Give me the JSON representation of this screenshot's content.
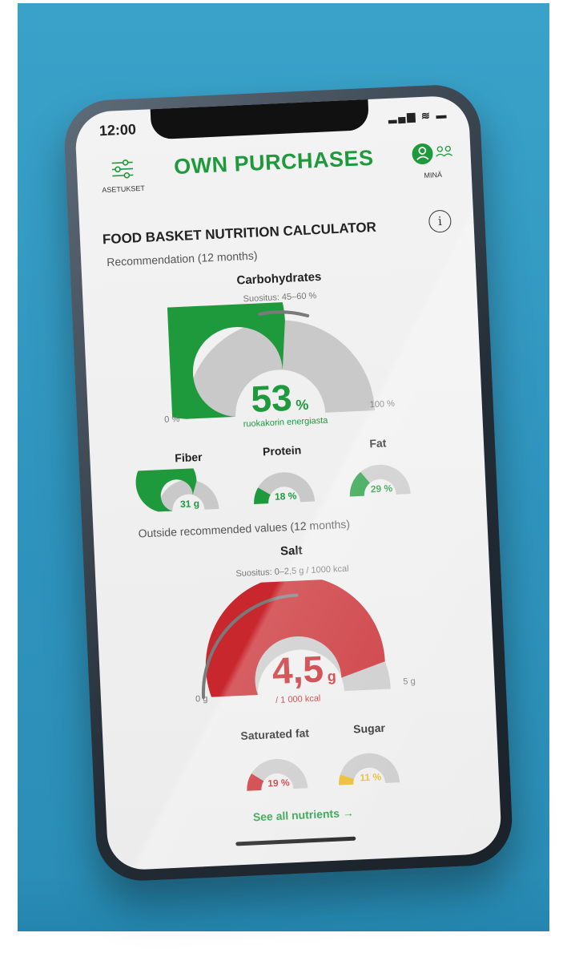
{
  "status_bar": {
    "time": "12:00"
  },
  "header": {
    "settings_label": "ASETUKSET",
    "title": "OWN PURCHASES",
    "user_label": "MINÄ"
  },
  "calculator": {
    "title": "FOOD BASKET NUTRITION CALCULATOR",
    "recommendation_label": "Recommendation (12 months)",
    "carbohydrates": {
      "title": "Carbohydrates",
      "recommendation": "Suositus: 45–60 %",
      "value": "53",
      "unit": "%",
      "caption": "ruokakorin energiasta",
      "min_label": "0 %",
      "max_label": "100 %",
      "level": 0.53
    },
    "small_gauges": [
      {
        "title": "Fiber",
        "value": "31 g",
        "level": 0.6
      },
      {
        "title": "Protein",
        "value": "18 %",
        "level": 0.18
      },
      {
        "title": "Fat",
        "value": "29 %",
        "level": 0.29
      }
    ],
    "outside_label": "Outside recommended values (12 months)",
    "salt": {
      "title": "Salt",
      "recommendation": "Suositus: 0–2,5 g / 1000 kcal",
      "value": "4,5",
      "unit": "g",
      "caption": "/ 1 000 kcal",
      "min_label": "0 g",
      "max_label": "5 g",
      "level": 0.9
    },
    "outside_gauges": [
      {
        "title": "Saturated fat",
        "value": "19 %",
        "level": 0.19
      },
      {
        "title": "Sugar",
        "value": "11 %",
        "level": 0.11
      }
    ],
    "see_all": "See all nutrients →"
  },
  "colors": {
    "green": "#1e9a3c",
    "red": "#c8282d",
    "yellow": "#e8b820",
    "track": "#c9c9c9",
    "marker": "#7a7a7a"
  }
}
